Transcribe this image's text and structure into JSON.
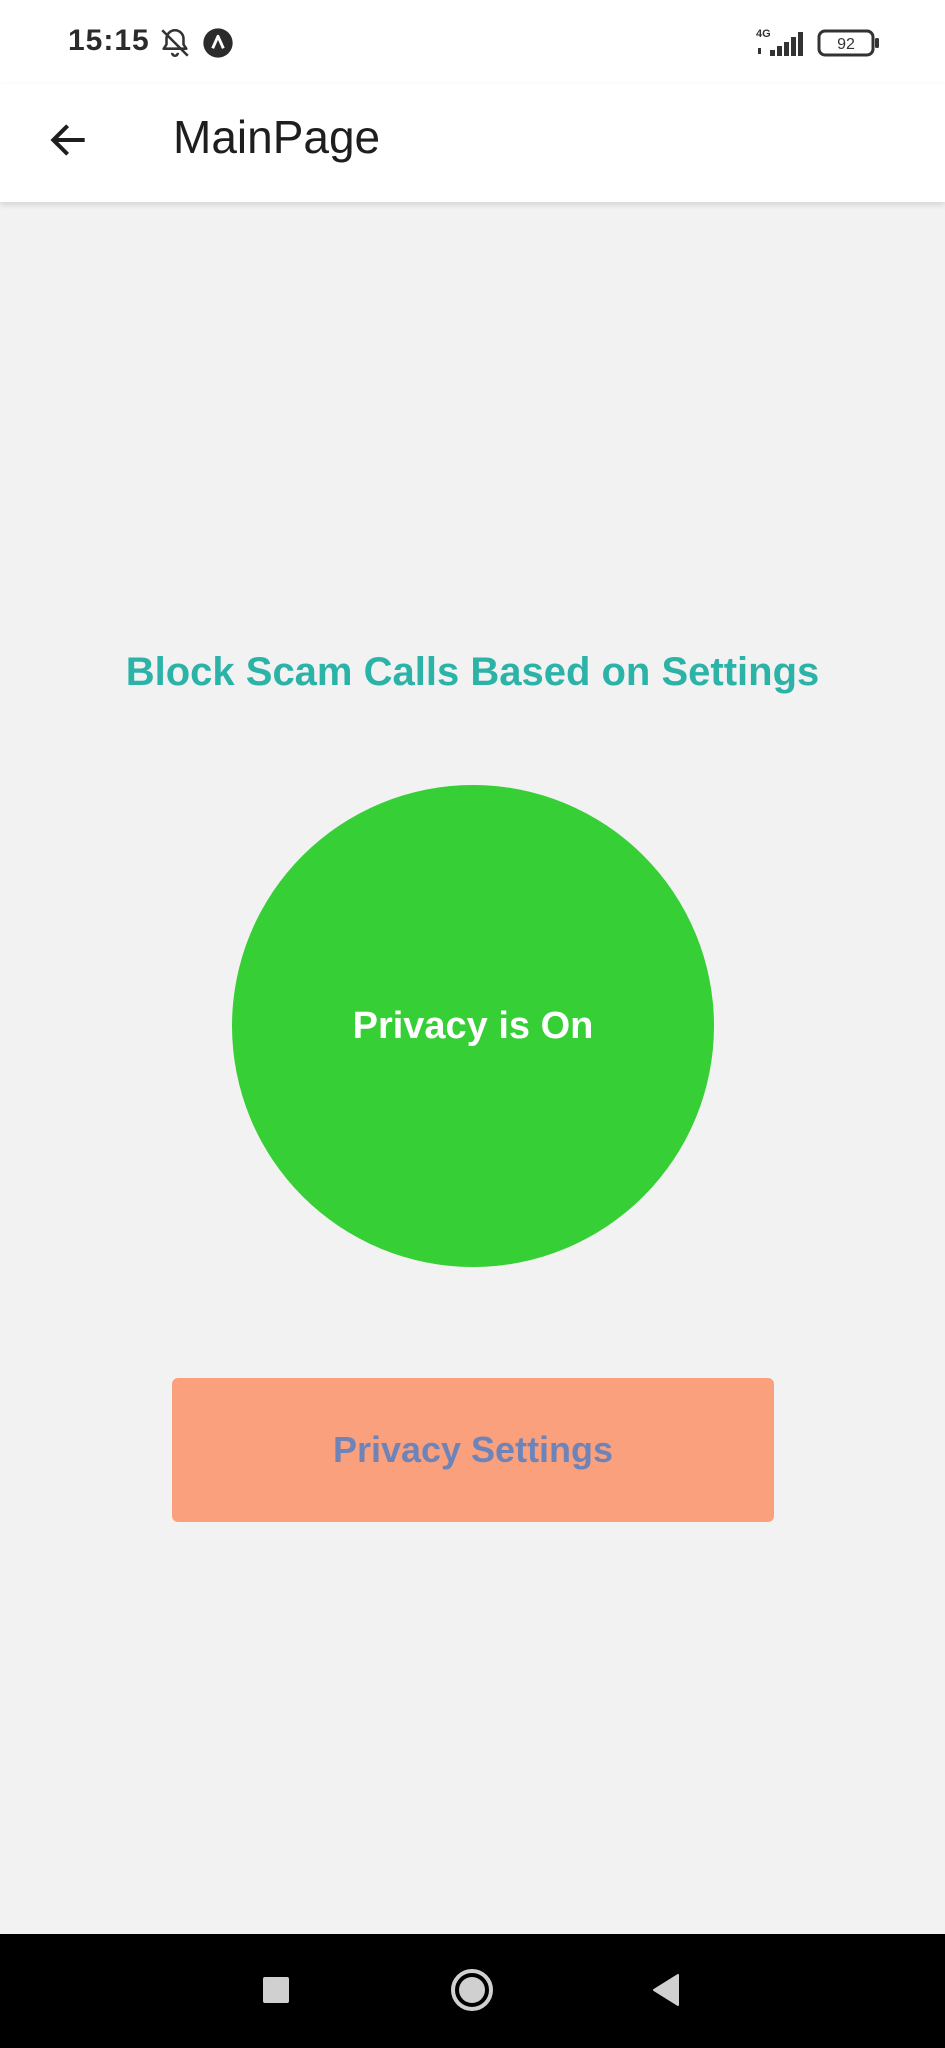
{
  "status_bar": {
    "time": "15:15",
    "network": "4G",
    "battery": "92",
    "icons": [
      "bell-off-icon",
      "app-notification-icon",
      "signal-icon",
      "battery-icon"
    ]
  },
  "app_bar": {
    "title": "MainPage",
    "back_icon": "arrow-left-icon"
  },
  "main": {
    "headline": "Block Scam Calls Based on Settings",
    "status_label": "Privacy is On",
    "settings_button_label": "Privacy Settings"
  },
  "colors": {
    "headline": "#2bb3a8",
    "circle_on": "#36cf36",
    "settings_button_bg": "#fba07c",
    "settings_button_text": "#6e84b8",
    "page_bg": "#f3f2f2"
  },
  "nav_bar": {
    "icons": [
      "recent-apps-icon",
      "home-icon",
      "back-icon"
    ]
  }
}
